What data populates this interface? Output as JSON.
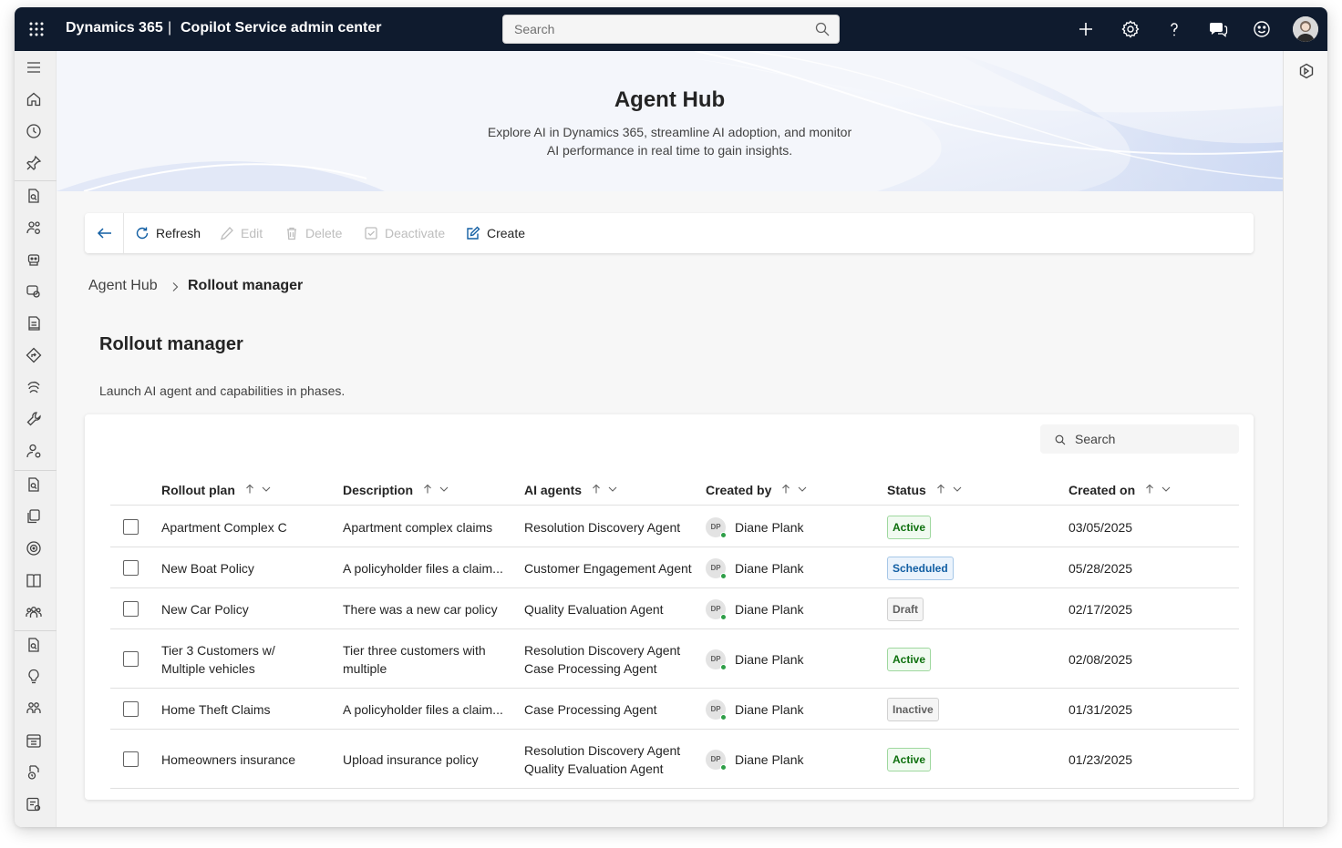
{
  "topbar": {
    "brand": "Dynamics 365",
    "separator": "|",
    "app_name": "Copilot Service admin center",
    "search_placeholder": "Search"
  },
  "hero": {
    "title": "Agent Hub",
    "subtitle": "Explore AI in Dynamics 365, streamline AI adoption, and monitor AI performance in real time to gain insights."
  },
  "commands": {
    "refresh": "Refresh",
    "edit": "Edit",
    "delete": "Delete",
    "deactivate": "Deactivate",
    "create": "Create"
  },
  "breadcrumb": {
    "parent": "Agent Hub",
    "current": "Rollout manager"
  },
  "page": {
    "title": "Rollout manager",
    "description": "Launch AI agent and capabilities in phases."
  },
  "table": {
    "search_placeholder": "Search",
    "columns": [
      "Rollout plan",
      "Description",
      "AI agents",
      "Created by",
      "Status",
      "Created on"
    ],
    "rows": [
      {
        "plan": [
          "Apartment Complex C"
        ],
        "description": [
          "Apartment complex claims"
        ],
        "agents": [
          "Resolution Discovery Agent"
        ],
        "initials": "DP",
        "created_by": "Diane Plank",
        "status": "Active",
        "status_kind": "active",
        "created_on": "03/05/2025"
      },
      {
        "plan": [
          "New Boat Policy"
        ],
        "description": [
          "A policyholder files a claim..."
        ],
        "agents": [
          "Customer Engagement Agent"
        ],
        "initials": "DP",
        "created_by": "Diane Plank",
        "status": "Scheduled",
        "status_kind": "scheduled",
        "created_on": "05/28/2025"
      },
      {
        "plan": [
          "New Car Policy"
        ],
        "description": [
          "There was a new car policy"
        ],
        "agents": [
          "Quality Evaluation Agent"
        ],
        "initials": "DP",
        "created_by": "Diane Plank",
        "status": "Draft",
        "status_kind": "draft",
        "created_on": "02/17/2025"
      },
      {
        "plan": [
          "Tier 3 Customers w/",
          "Multiple vehicles"
        ],
        "description": [
          "Tier three customers with",
          "multiple"
        ],
        "agents": [
          "Resolution Discovery Agent",
          "Case Processing Agent"
        ],
        "initials": "DP",
        "created_by": "Diane Plank",
        "status": "Active",
        "status_kind": "active",
        "created_on": "02/08/2025"
      },
      {
        "plan": [
          "Home Theft Claims"
        ],
        "description": [
          "A policyholder files a claim..."
        ],
        "agents": [
          "Case Processing Agent"
        ],
        "initials": "DP",
        "created_by": "Diane Plank",
        "status": "Inactive",
        "status_kind": "inactive",
        "created_on": "01/31/2025"
      },
      {
        "plan": [
          "Homeowners insurance"
        ],
        "description": [
          "Upload insurance policy"
        ],
        "agents": [
          "Resolution Discovery Agent",
          "Quality Evaluation Agent"
        ],
        "initials": "DP",
        "created_by": "Diane Plank",
        "status": "Active",
        "status_kind": "active",
        "created_on": "01/23/2025"
      }
    ]
  },
  "colors": {
    "topbar": "#0f1b2e",
    "accent": "#115ea3",
    "active": "#0e700e",
    "presence": "#2e9e47"
  },
  "icons": {
    "rail": [
      "menu-icon",
      "home-icon",
      "recent-icon",
      "pin-icon",
      "document-search-icon",
      "people-settings-icon",
      "bot-icon",
      "chat-settings-icon",
      "notebook-icon",
      "routing-icon",
      "fingerprint-icon",
      "wrench-icon",
      "person-settings-icon",
      "document-search-icon",
      "copy-icon",
      "target-icon",
      "book-icon",
      "people-team-icon",
      "document-search-icon",
      "lightbulb-icon",
      "people-queue-icon",
      "calendar-icon",
      "document-clock-icon",
      "list-settings-icon"
    ],
    "right_rail": [
      "copilot-icon"
    ]
  }
}
